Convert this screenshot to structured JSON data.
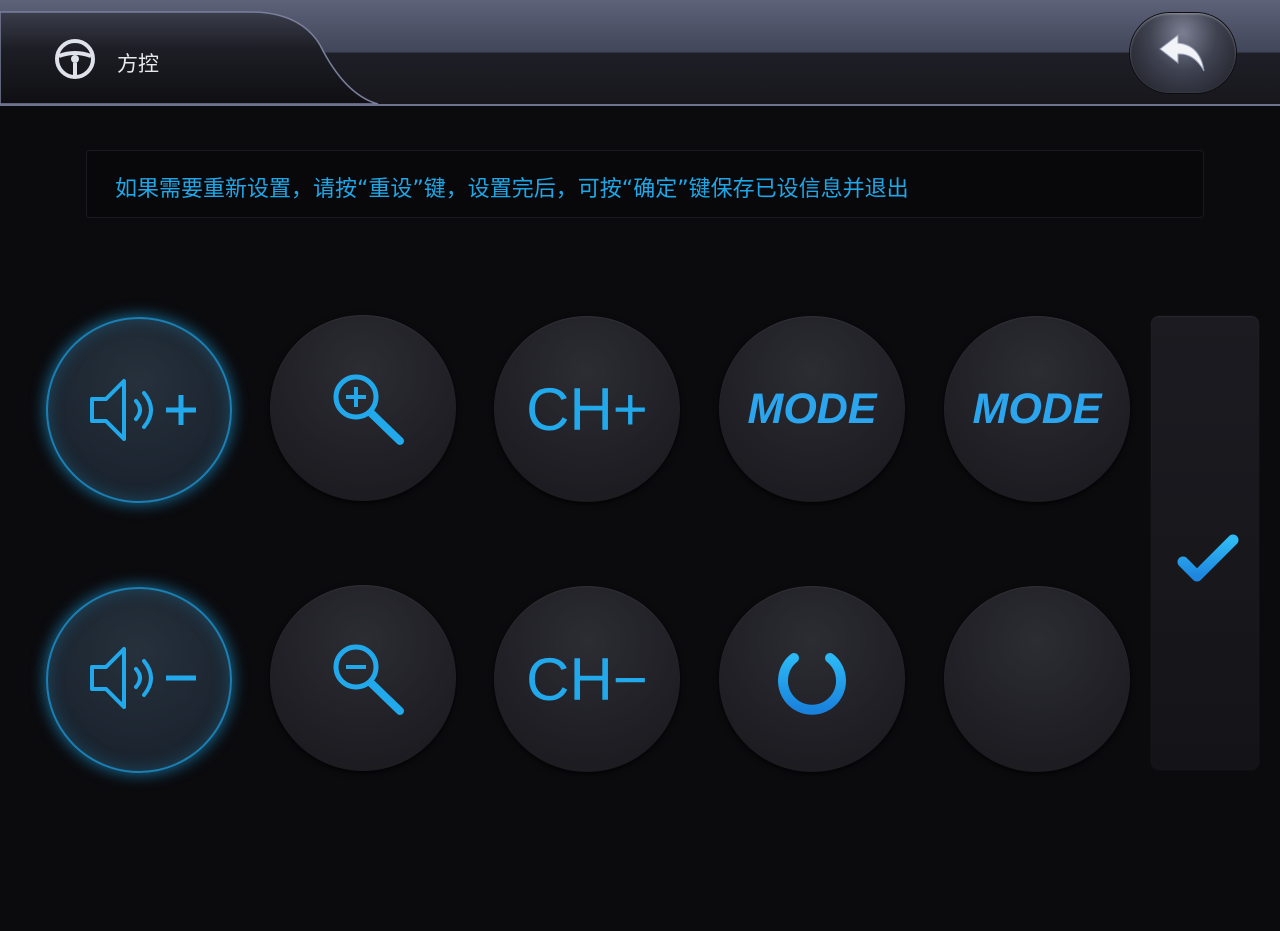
{
  "header": {
    "title": "方控",
    "title_icon": "steering-wheel-icon",
    "back_icon": "back-arrow-icon"
  },
  "info": {
    "text": "如果需要重新设置，请按“重设”键，设置完后，可按“确定”键保存已设信息并退出"
  },
  "buttons": {
    "row1": [
      {
        "name": "volume-up",
        "icon": "volume-up-icon"
      },
      {
        "name": "zoom-in",
        "icon": "zoom-in-icon"
      },
      {
        "name": "channel-up",
        "label": "CH+"
      },
      {
        "name": "mode-1",
        "label": "MODE"
      },
      {
        "name": "mode-2",
        "label": "MODE"
      }
    ],
    "row2": [
      {
        "name": "volume-down",
        "icon": "volume-down-icon"
      },
      {
        "name": "zoom-out",
        "icon": "zoom-out-icon"
      },
      {
        "name": "channel-down",
        "label": "CH−"
      },
      {
        "name": "power",
        "icon": "power-icon"
      },
      {
        "name": "empty",
        "label": ""
      }
    ]
  },
  "confirm": {
    "icon": "checkmark-icon"
  },
  "colors": {
    "accent": "#1fa6e6",
    "background": "#0b0b0e",
    "header_top": "#5d6279"
  }
}
